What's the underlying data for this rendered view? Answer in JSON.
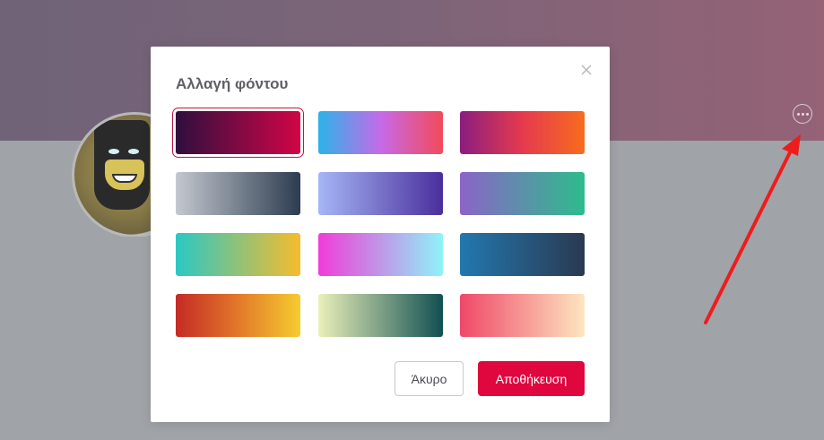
{
  "modal": {
    "title": "Αλλαγή φόντου",
    "cancel_label": "Άκυρο",
    "save_label": "Αποθήκευση"
  },
  "swatches": [
    {
      "from": "#2e0f3e",
      "to": "#d10547",
      "selected": true
    },
    {
      "from": "#2cb3e8",
      "via": "#c66ae8",
      "to": "#f24a5a",
      "selected": false
    },
    {
      "from": "#8a1e7e",
      "via": "#e53a4e",
      "to": "#f86c1e",
      "selected": false
    },
    {
      "from": "#c4c8cf",
      "to": "#2c3c50",
      "selected": false
    },
    {
      "from": "#a5b6f5",
      "to": "#4a2e9c",
      "selected": false
    },
    {
      "from": "#8b64c8",
      "to": "#2dbc8c",
      "selected": false
    },
    {
      "from": "#2ac8c4",
      "to": "#f6bc2c",
      "selected": false
    },
    {
      "from": "#f03cd8",
      "to": "#8ef3f8",
      "selected": false
    },
    {
      "from": "#2278b0",
      "to": "#2a3950",
      "selected": false
    },
    {
      "from": "#c42a26",
      "via": "#e2782a",
      "to": "#f6cc30",
      "selected": false
    },
    {
      "from": "#eaf0ba",
      "to": "#115052",
      "selected": false
    },
    {
      "from": "#f04868",
      "to": "#fde6c0",
      "selected": false
    }
  ],
  "colors": {
    "accent": "#e0063e",
    "selected_outline": "#c8103e"
  },
  "icons": [
    "close-icon",
    "more-options-icon"
  ]
}
